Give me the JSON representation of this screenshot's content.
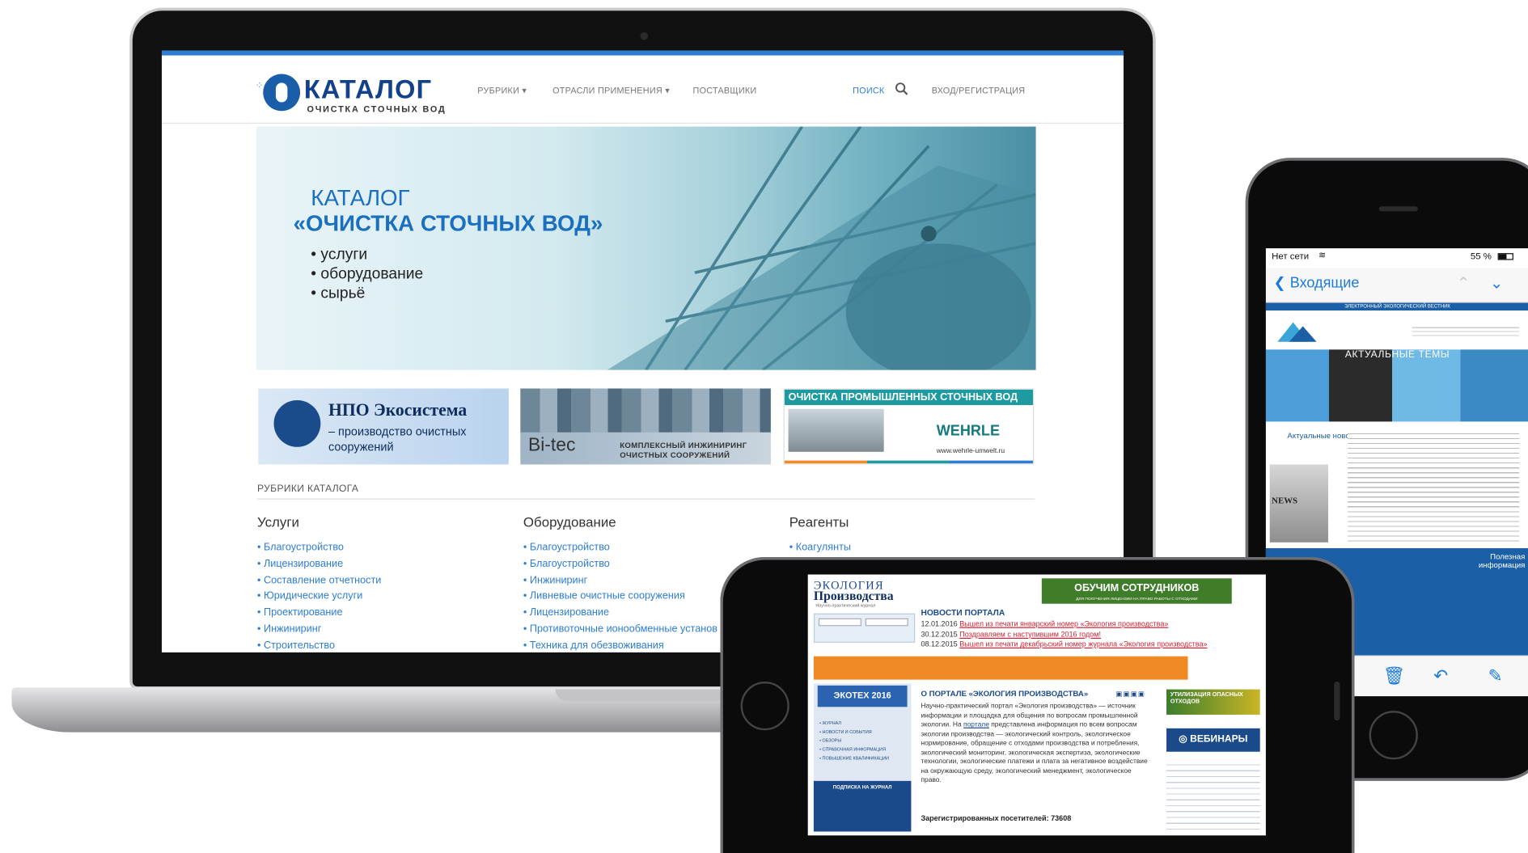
{
  "laptop": {
    "logo": {
      "title": "КАТАЛОГ",
      "subtitle": "ОЧИСТКА СТОЧНЫХ ВОД"
    },
    "nav": {
      "rubrics": "РУБРИКИ ▾",
      "industries": "ОТРАСЛИ ПРИМЕНЕНИЯ ▾",
      "suppliers": "ПОСТАВЩИКИ",
      "search": "ПОИСК",
      "login": "ВХОД/РЕГИСТРАЦИЯ"
    },
    "hero": {
      "kicker": "КАТАЛОГ",
      "title": "«ОЧИСТКА СТОЧНЫХ ВОД»",
      "items": [
        "• услуги",
        "• оборудование",
        "• сырьё"
      ]
    },
    "banners": {
      "eco": {
        "title": "НПО Экосистема",
        "subtitle": "– производство очистных сооружений"
      },
      "bitec": {
        "brand": "Bi-tec",
        "text": "КОМПЛЕКСНЫЙ ИНЖИНИРИНГ ОЧИСТНЫХ СООРУЖЕНИЙ"
      },
      "wehrle": {
        "strip": "ОЧИСТКА ПРОМЫШЛЕННЫХ СТОЧНЫХ ВОД",
        "brand": "WEHRLE",
        "url": "www.wehrle-umwelt.ru"
      }
    },
    "rubrics": {
      "heading": "РУБРИКИ КАТАЛОГА",
      "columns": [
        {
          "title": "Услуги",
          "items": [
            "Благоустройство",
            "Лицензирование",
            "Составление отчетности",
            "Юридические услуги",
            "Проектирование",
            "Инжиниринг",
            "Строительство"
          ]
        },
        {
          "title": "Оборудование",
          "items": [
            "Благоустройство",
            "Благоустройство",
            "Инжиниринг",
            "Ливневые очистные сооружения",
            "Лицензирование",
            "Противоточные ионообменные установ",
            "Техника для обезвоживания"
          ]
        },
        {
          "title": "Реагенты",
          "items": [
            "Коагулянты"
          ]
        }
      ]
    }
  },
  "phone_portrait": {
    "status": {
      "carrier": "Нет сети",
      "battery": "55 %"
    },
    "mail": {
      "back": "Входящие"
    },
    "newsletter": {
      "header": "ЭЛЕКТРОННЫЙ ЭКОЛОГИЧЕСКИЙ ВЕСТНИК",
      "topics": "АКТУАЛЬНЫЕ ТЕМЫ",
      "section1": "Актуальные новости",
      "section2": "Полезная информация",
      "news_label": "NEWS"
    },
    "toolbar": {
      "trash": "🗑",
      "reply": "↶",
      "compose": "✎"
    }
  },
  "phone_landscape": {
    "logo": {
      "line1": "ЭКОЛОГИЯ",
      "line2": "Производства",
      "tag": "Научно-практический журнал"
    },
    "training": {
      "title": "ОБУЧИМ СОТРУДНИКОВ",
      "sub": "ДЛЯ ПОЛУЧЕНИЯ ЛИЦЕНЗИИ НА ПРАВО РАБОТЫ С ОТХОДАМИ"
    },
    "news": {
      "heading": "НОВОСТИ ПОРТАЛА",
      "items": [
        {
          "date": "12.01.2016",
          "text": "Вышел из печати январский номер «Экология производства»"
        },
        {
          "date": "30.12.2015",
          "text": "Поздравляем с наступившим 2016 годом!"
        },
        {
          "date": "08.12.2015",
          "text": "Вышел из печати декабрьский номер журнала «Экология производства»"
        }
      ]
    },
    "ecotech": "ЭКОТЕХ 2016",
    "left_links": [
      "• ЖУРНАЛ",
      "• НОВОСТИ И СОБЫТИЯ",
      "• ОБЗОРЫ",
      "• СПРАВОЧНАЯ ИНФОРМАЦИЯ",
      "• ПОВЫШЕНИЕ КВАЛИФИКАЦИИ"
    ],
    "subscribe": "ПОДПИСКА НА ЖУРНАЛ",
    "about": {
      "heading": "О ПОРТАЛЕ «ЭКОЛОГИЯ ПРОИЗВОДСТВА»",
      "text_before": "Научно-практический портал «Экология производства» — источник информации и площадка для общения по вопросам промышленной экологии. На ",
      "link": "портале",
      "text_after": " представлена информация по всем вопросам экологии производства — экологический контроль, экологическое нормирование, обращение с отходами производства и потребления, экологический мониторинг, экологическая экспертиза, экологические технологии, экологические платежи и плата за негативное воздействие на окружающую среду, экологический менеджмент, экологическое право."
    },
    "visitors": "Зарегистрированных посетителей: 73608",
    "waste": "УТИЛИЗАЦИЯ ОПАСНЫХ ОТХОДОВ",
    "webinars": "ВЕБИНАРЫ"
  },
  "colors": {
    "accent": "#2d7dd2",
    "brand_dark": "#13418a",
    "teal": "#1d9ba0",
    "orange": "#f08a24"
  }
}
